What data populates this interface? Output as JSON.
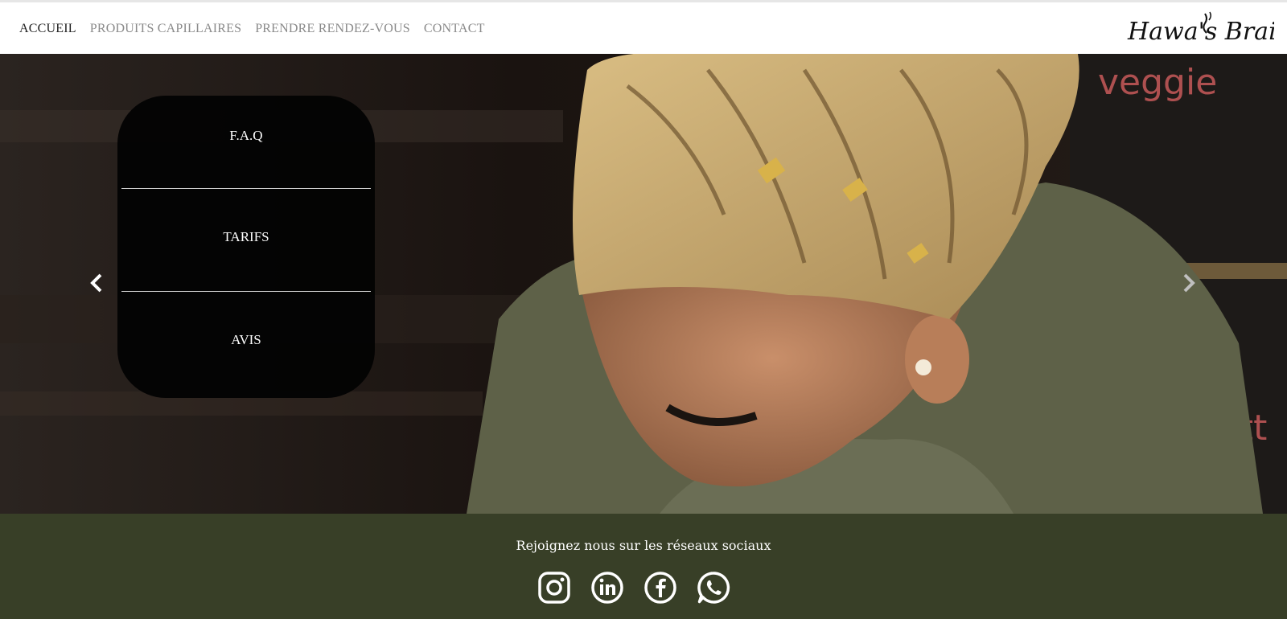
{
  "nav": {
    "items": [
      {
        "label": "ACCUEIL",
        "active": true
      },
      {
        "label": "PRODUITS CAPILLAIRES",
        "active": false
      },
      {
        "label": "PRENDRE RENDEZ-VOUS",
        "active": false
      },
      {
        "label": "CONTACT",
        "active": false
      }
    ]
  },
  "logo": {
    "text": "Hawa's Braids"
  },
  "hero": {
    "menu": [
      {
        "label": "F.A.Q"
      },
      {
        "label": "TARIFS"
      },
      {
        "label": "AVIS"
      }
    ],
    "prev_icon": "chevron-left-icon",
    "next_icon": "chevron-right-icon"
  },
  "footer": {
    "title": "Rejoignez nous sur les réseaux sociaux",
    "socials": [
      "instagram-icon",
      "linkedin-icon",
      "facebook-icon",
      "whatsapp-icon"
    ]
  },
  "colors": {
    "footer_bg": "#383f27",
    "nav_active": "#1f1f1f",
    "nav_inactive": "#8a8a8a"
  }
}
